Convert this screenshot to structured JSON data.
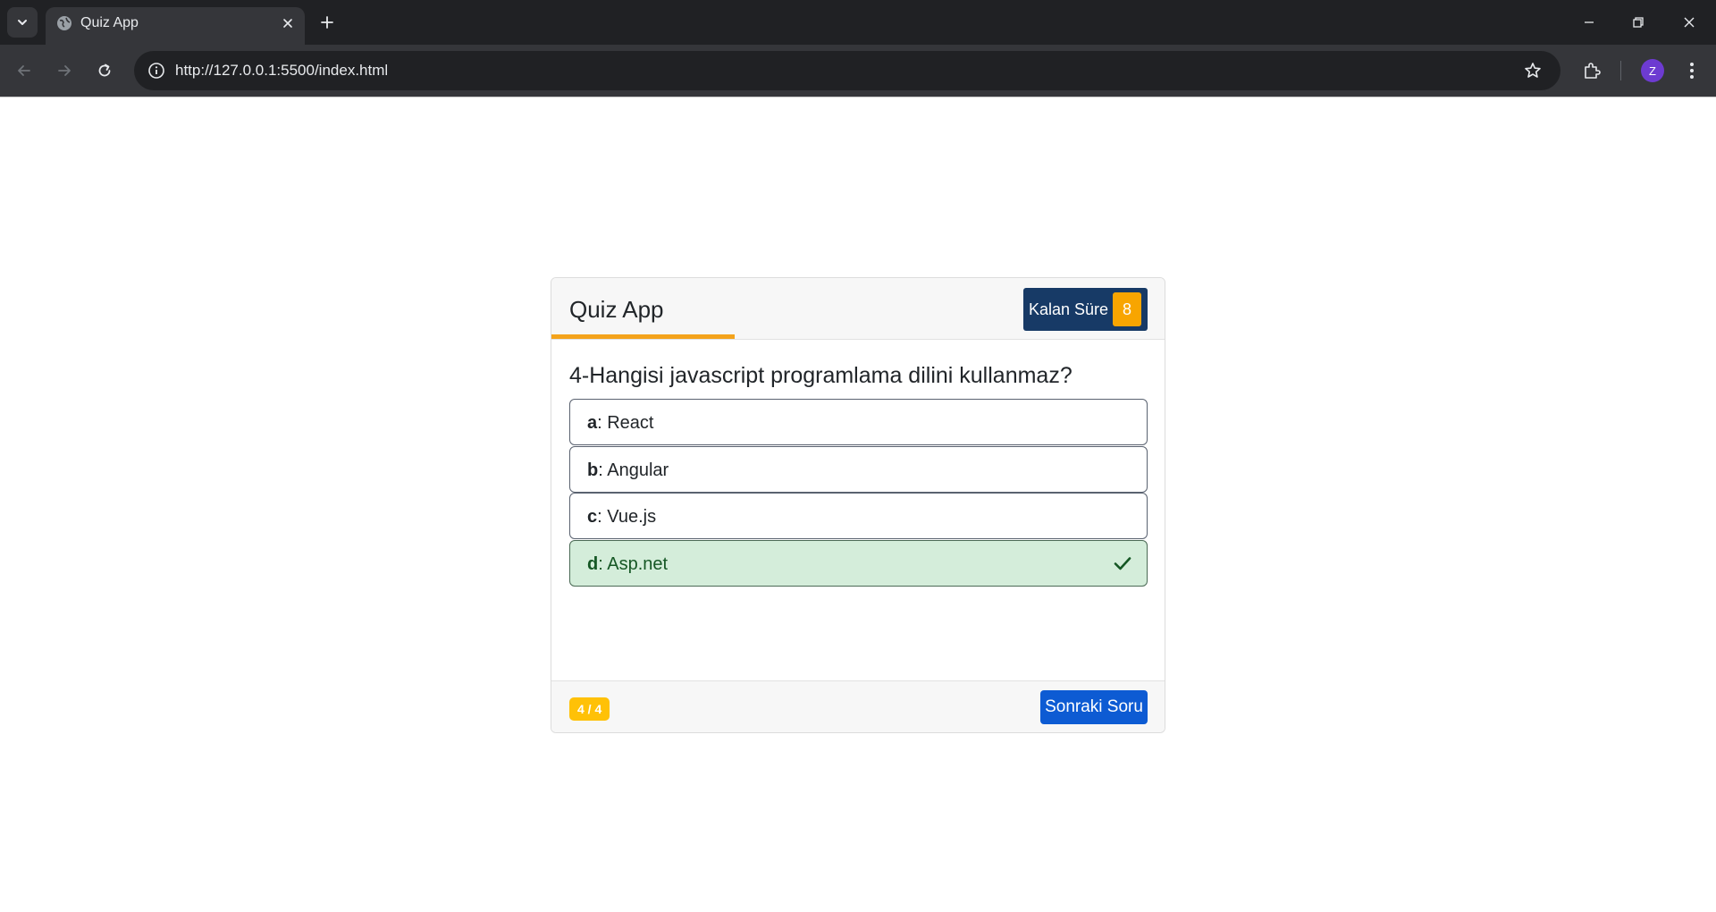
{
  "browser": {
    "tab_title": "Quiz App",
    "url": "http://127.0.0.1:5500/index.html",
    "profile_initial": "Z"
  },
  "quiz": {
    "title": "Quiz App",
    "timer_label": "Kalan Süre :",
    "timer_value": "8",
    "question": "4-Hangisi javascript programlama dilini kullanmaz?",
    "options": [
      {
        "key": "a",
        "text": ": React",
        "state": "default"
      },
      {
        "key": "b",
        "text": ": Angular",
        "state": "default"
      },
      {
        "key": "c",
        "text": ": Vue.js",
        "state": "default"
      },
      {
        "key": "d",
        "text": ": Asp.net",
        "state": "correct",
        "icon": "check-icon"
      }
    ],
    "counter": "4 / 4",
    "next_button": "Sonraki Soru"
  },
  "colors": {
    "timer_bg": "#173a66",
    "timer_value_bg": "#f8a500",
    "accent_underline": "#f4a31b",
    "correct_bg": "#d4edda",
    "correct_text": "#155724",
    "counter_bg": "#ffc107",
    "next_button_bg": "#0d5bd3"
  }
}
